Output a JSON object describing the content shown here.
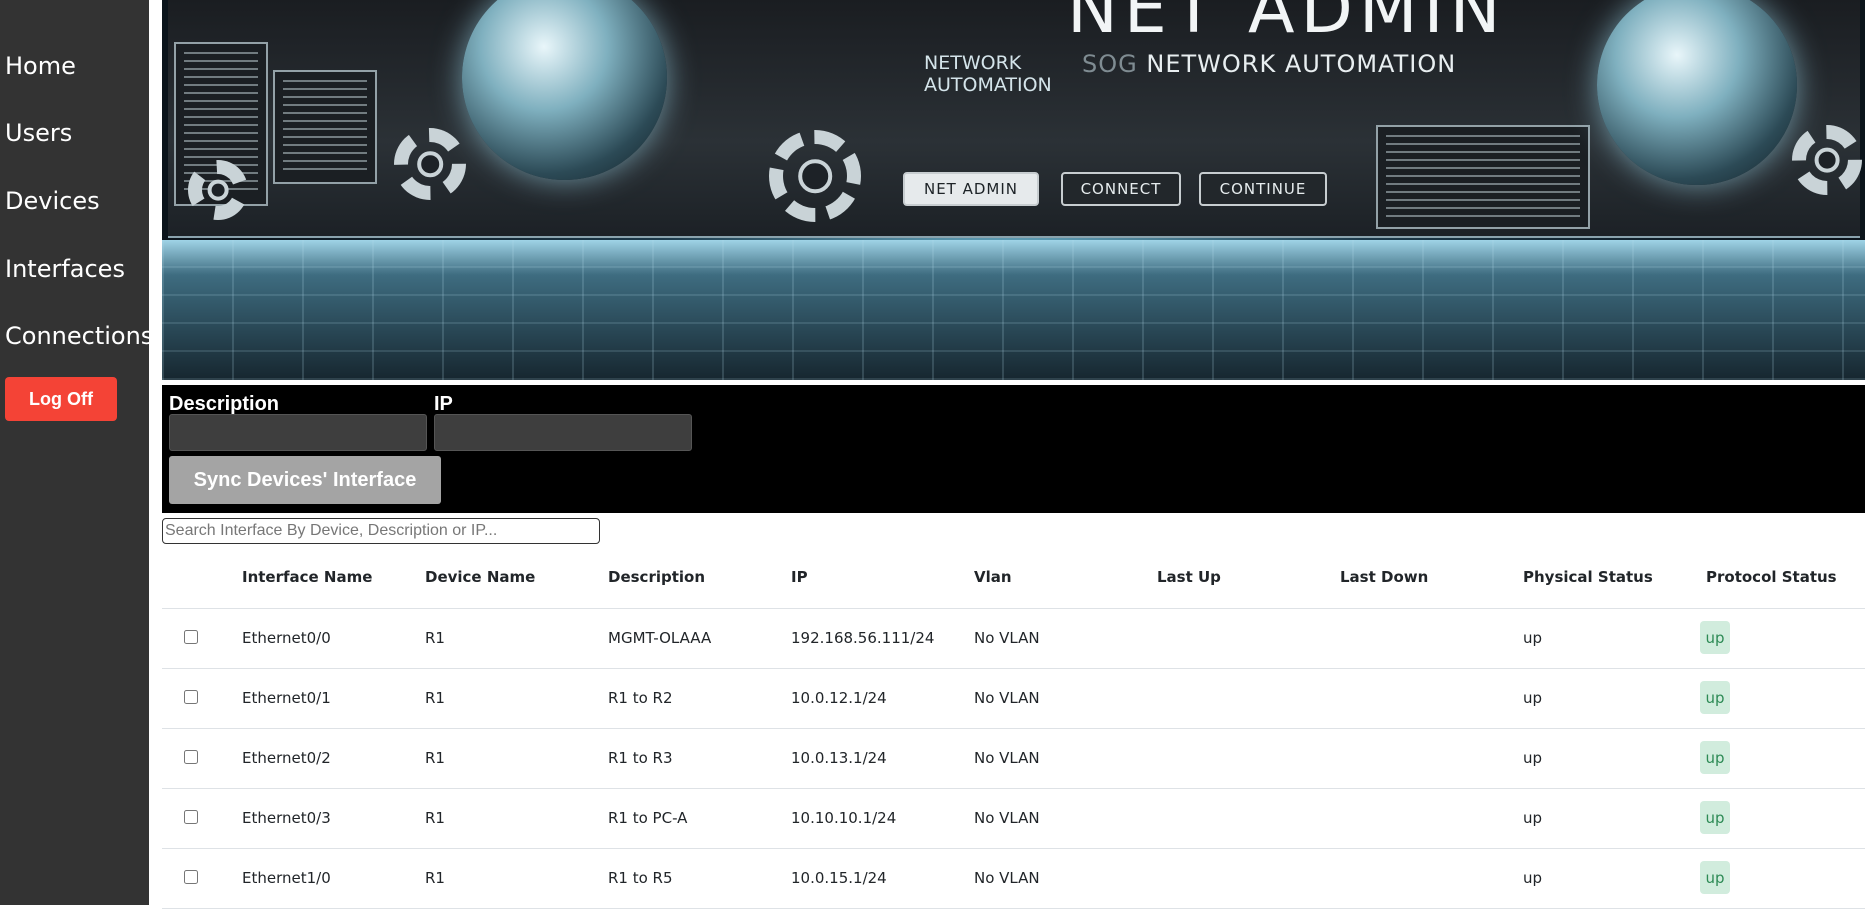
{
  "sidebar": {
    "items": [
      {
        "label": "Home"
      },
      {
        "label": "Users"
      },
      {
        "label": "Devices"
      },
      {
        "label": "Interfaces"
      },
      {
        "label": "Connections"
      }
    ],
    "logoff_label": "Log Off",
    "colors": {
      "background": "#333333",
      "logoff": "#f44336"
    }
  },
  "banner": {
    "title": "NET ADMIN",
    "subtitle_prefix": "SOG",
    "subtitle": "NETWORK AUTOMATION",
    "side_label_1": "NETWORK",
    "side_label_2": "AUTOMATION",
    "button_1": "NET ADMIN",
    "button_2": "CONNECT",
    "button_3": "CONTINUE"
  },
  "form": {
    "description_label": "Description",
    "description_value": "",
    "ip_label": "IP",
    "ip_value": "",
    "sync_button": "Sync Devices' Interface"
  },
  "search": {
    "placeholder": "Search Interface By Device, Description or IP..."
  },
  "table": {
    "columns": [
      "Interface Name",
      "Device Name",
      "Description",
      "IP",
      "Vlan",
      "Last Up",
      "Last Down",
      "Physical Status",
      "Protocol Status"
    ],
    "rows": [
      {
        "interface": "Ethernet0/0",
        "device": "R1",
        "description": "MGMT-OLAAA",
        "ip": "192.168.56.111/24",
        "vlan": "No VLAN",
        "last_up": "",
        "last_down": "",
        "physical": "up",
        "protocol": "up"
      },
      {
        "interface": "Ethernet0/1",
        "device": "R1",
        "description": "R1 to R2",
        "ip": "10.0.12.1/24",
        "vlan": "No VLAN",
        "last_up": "",
        "last_down": "",
        "physical": "up",
        "protocol": "up"
      },
      {
        "interface": "Ethernet0/2",
        "device": "R1",
        "description": "R1 to R3",
        "ip": "10.0.13.1/24",
        "vlan": "No VLAN",
        "last_up": "",
        "last_down": "",
        "physical": "up",
        "protocol": "up"
      },
      {
        "interface": "Ethernet0/3",
        "device": "R1",
        "description": "R1 to PC-A",
        "ip": "10.10.10.1/24",
        "vlan": "No VLAN",
        "last_up": "",
        "last_down": "",
        "physical": "up",
        "protocol": "up"
      },
      {
        "interface": "Ethernet1/0",
        "device": "R1",
        "description": "R1 to R5",
        "ip": "10.0.15.1/24",
        "vlan": "No VLAN",
        "last_up": "",
        "last_down": "",
        "physical": "up",
        "protocol": "up"
      }
    ],
    "badge_colors": {
      "background": "#d1ecdd",
      "text": "#2d8a55"
    }
  }
}
